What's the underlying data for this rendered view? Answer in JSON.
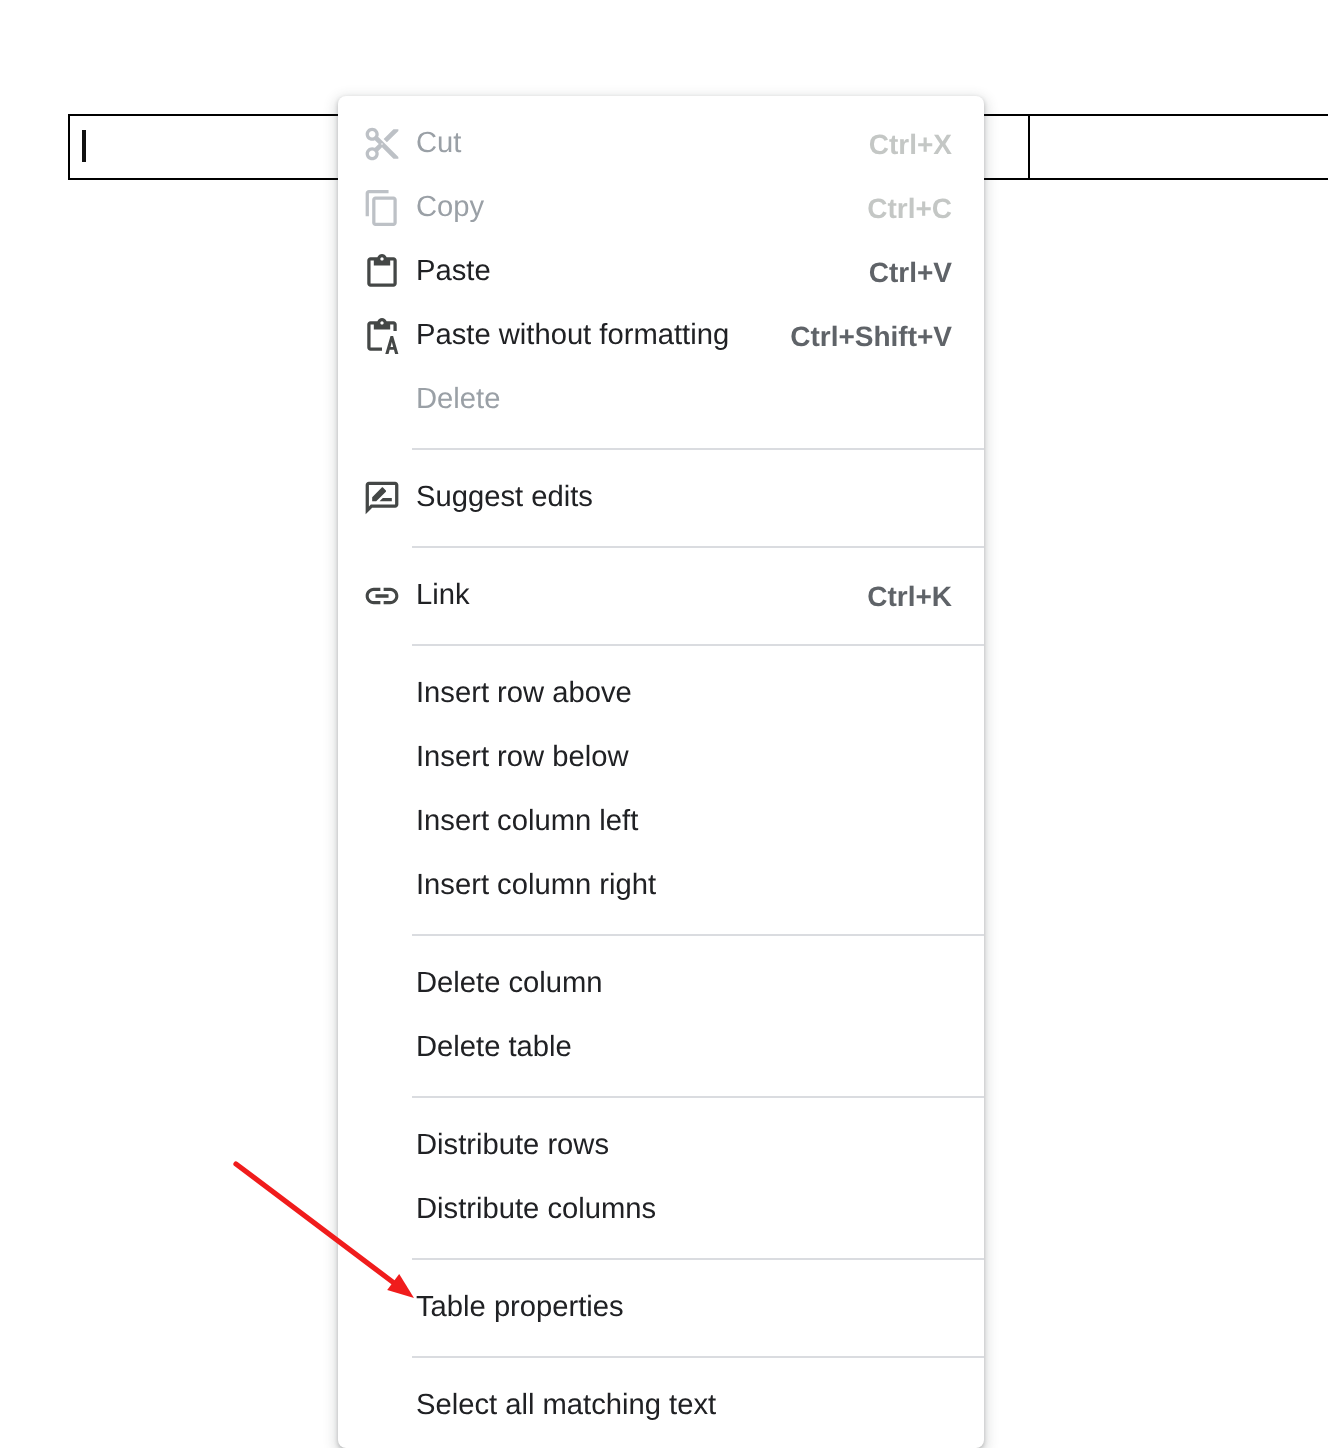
{
  "table": {
    "caret": true
  },
  "menu": {
    "sections": [
      {
        "items": [
          {
            "label": "Cut",
            "shortcut": "Ctrl+X",
            "disabled": true,
            "annotated": false
          },
          {
            "label": "Copy",
            "shortcut": "Ctrl+C",
            "disabled": true,
            "annotated": false
          },
          {
            "label": "Paste",
            "shortcut": "Ctrl+V",
            "disabled": false,
            "annotated": false
          },
          {
            "label": "Paste without formatting",
            "shortcut": "Ctrl+Shift+V",
            "disabled": false,
            "annotated": false
          },
          {
            "label": "Delete",
            "disabled": true,
            "annotated": false
          }
        ]
      },
      {
        "items": [
          {
            "label": "Suggest edits",
            "disabled": false,
            "annotated": false
          }
        ]
      },
      {
        "items": [
          {
            "label": "Link",
            "shortcut": "Ctrl+K",
            "disabled": false,
            "annotated": false
          }
        ]
      },
      {
        "items": [
          {
            "label": "Insert row above",
            "disabled": false,
            "annotated": false
          },
          {
            "label": "Insert row below",
            "disabled": false,
            "annotated": false
          },
          {
            "label": "Insert column left",
            "disabled": false,
            "annotated": false
          },
          {
            "label": "Insert column right",
            "disabled": false,
            "annotated": false
          }
        ]
      },
      {
        "items": [
          {
            "label": "Delete column",
            "disabled": false,
            "annotated": false
          },
          {
            "label": "Delete table",
            "disabled": false,
            "annotated": false
          }
        ]
      },
      {
        "items": [
          {
            "label": "Distribute rows",
            "disabled": false,
            "annotated": false
          },
          {
            "label": "Distribute columns",
            "disabled": false,
            "annotated": false
          }
        ]
      },
      {
        "items": [
          {
            "label": "Table properties",
            "disabled": false,
            "annotated": true
          }
        ]
      },
      {
        "items": [
          {
            "label": "Select all matching text",
            "disabled": false,
            "annotated": false
          }
        ]
      }
    ]
  }
}
